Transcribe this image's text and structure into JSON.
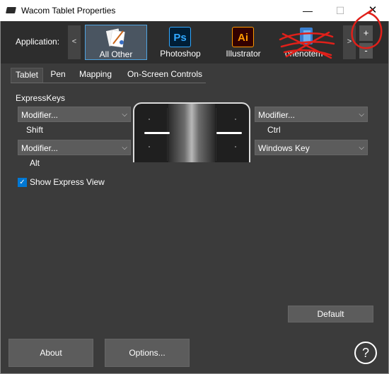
{
  "window": {
    "title": "Wacom Tablet Properties",
    "controls": {
      "minimize": "—",
      "maximize": "☐",
      "close": "✕"
    }
  },
  "app_bar": {
    "label": "Application:",
    "scroll_left": "<",
    "scroll_right": ">",
    "add": "+",
    "remove": "-",
    "apps": [
      {
        "label": "All Other",
        "selected": true
      },
      {
        "label": "Photoshop",
        "icon_text": "Ps"
      },
      {
        "label": "Illustrator",
        "icon_text": "Ai"
      },
      {
        "label": "onenotem"
      }
    ]
  },
  "tabs": [
    {
      "label": "Tablet",
      "active": true
    },
    {
      "label": "Pen"
    },
    {
      "label": "Mapping"
    },
    {
      "label": "On-Screen Controls"
    }
  ],
  "express_keys": {
    "section_label": "ExpressKeys",
    "left_top": {
      "value": "Modifier...",
      "detail": "Shift"
    },
    "left_bottom": {
      "value": "Modifier...",
      "detail": "Alt"
    },
    "right_top": {
      "value": "Modifier...",
      "detail": "Ctrl"
    },
    "right_bottom": {
      "value": "Windows Key"
    }
  },
  "show_express_view": {
    "label": "Show Express View",
    "checked": true
  },
  "buttons": {
    "default": "Default",
    "about": "About",
    "options": "Options...",
    "help": "?"
  },
  "colors": {
    "window_bg": "#3b3b3b",
    "app_bar_bg": "#2d2d2d",
    "control_bg": "#5c5c5c",
    "accent": "#0078d4",
    "annotation_red": "#e0201a"
  },
  "icons": {
    "app": "tablet-icon",
    "chevron": "chevron-down-icon",
    "help": "help-circle-icon",
    "check": "checkmark-icon"
  }
}
